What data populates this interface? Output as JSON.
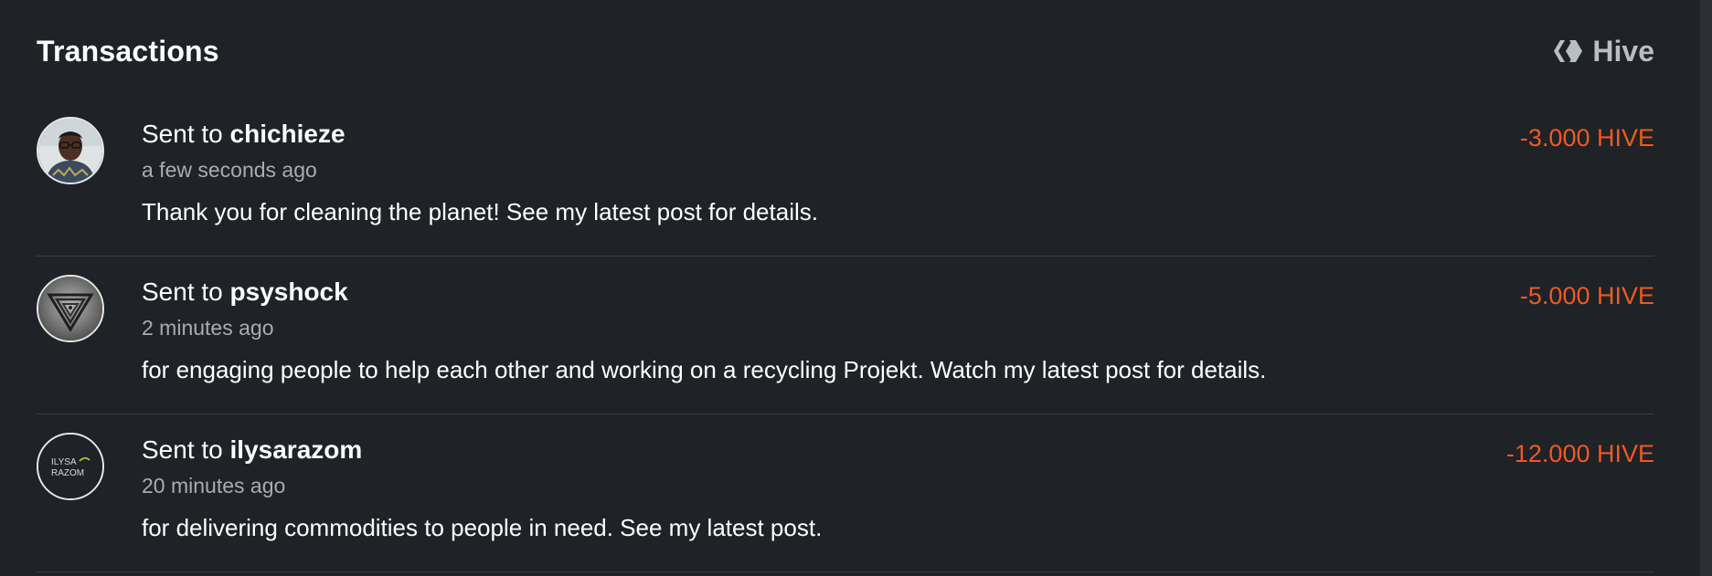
{
  "header": {
    "title": "Transactions",
    "network_label": "Hive",
    "network_icon": "hive-logo-icon"
  },
  "colors": {
    "background": "#1f2226",
    "amount_negative": "#ed5a22",
    "muted_text": "#a8adb3"
  },
  "transactions": [
    {
      "prefix": "Sent to",
      "recipient": "chichieze",
      "time": "a few seconds ago",
      "memo": "Thank you for cleaning the planet! See my latest post for details.",
      "amount": "-3.000 HIVE",
      "avatar_icon": "profile-photo-avatar"
    },
    {
      "prefix": "Sent to",
      "recipient": "psyshock",
      "time": "2 minutes ago",
      "memo": "for engaging people to help each other and working on a recycling Projekt. Watch my latest post for details.",
      "amount": "-5.000 HIVE",
      "avatar_icon": "triangle-spiral-avatar"
    },
    {
      "prefix": "Sent to",
      "recipient": "ilysarazom",
      "time": "20 minutes ago",
      "memo": "for delivering commodities to people in need. See my latest post.",
      "amount": "-12.000 HIVE",
      "avatar_icon": "ilysa-razom-logo-avatar",
      "avatar_text_1": "ILYSA",
      "avatar_text_2": "RAZOM"
    }
  ]
}
